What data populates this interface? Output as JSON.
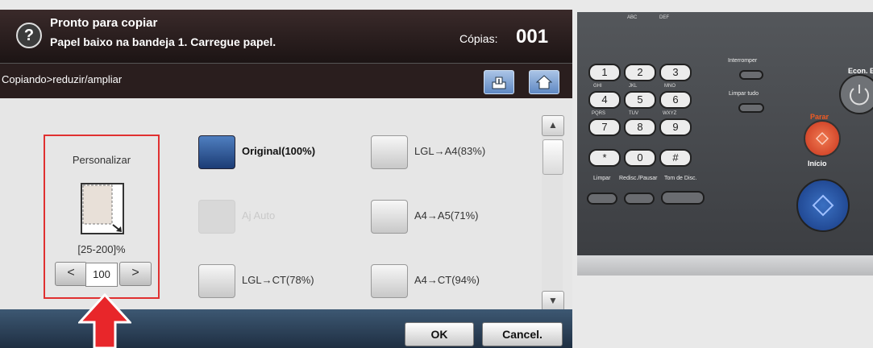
{
  "screen": {
    "header": {
      "help_icon": "?",
      "status_title": "Pronto para copiar",
      "status_message": "Papel baixo na bandeja 1. Carregue papel.",
      "copies_label": "Cópias:",
      "copies_value": "001"
    },
    "breadcrumb": "Copiando>reduzir/ampliar",
    "custom": {
      "label": "Personalizar",
      "range": "[25-200]%",
      "decrease": "<",
      "value": "100",
      "increase": ">"
    },
    "options": [
      {
        "label": "Original(100%)",
        "selected": true,
        "disabled": false
      },
      {
        "label": "Aj Auto",
        "selected": false,
        "disabled": true
      },
      {
        "label": "LGL→CT(78%)",
        "selected": false,
        "disabled": false
      },
      {
        "label": "LGL→A4(83%)",
        "selected": false,
        "disabled": false
      },
      {
        "label": "A4→A5(71%)",
        "selected": false,
        "disabled": false
      },
      {
        "label": "A4→CT(94%)",
        "selected": false,
        "disabled": false
      }
    ],
    "scroll": {
      "up": "▲",
      "down": "▼"
    },
    "buttons": {
      "ok": "OK",
      "cancel": "Cancel."
    },
    "colors": {
      "highlight_box": "#e03030",
      "arrow": "#e8262a",
      "selected_option": "#1c3c75"
    }
  },
  "panel": {
    "keys": [
      "1",
      "2",
      "3",
      "4",
      "5",
      "6",
      "7",
      "8",
      "9",
      "*",
      "0",
      "#"
    ],
    "letters": [
      "ABC",
      "DEF",
      "GHI",
      "JKL",
      "MNO",
      "PQRS",
      "TUV",
      "WXYZ"
    ],
    "labels": {
      "interrupt": "Interromper",
      "clear_all": "Limpar tudo",
      "clear": "Limpar",
      "redial": "Redisc./Pausar",
      "dial_tone": "Tom de Disc.",
      "econ": "Econ. Ener",
      "stop": "Parar",
      "start": "Início"
    },
    "colors": {
      "stop": "#f15a22",
      "start": "#1f4b9a"
    }
  }
}
